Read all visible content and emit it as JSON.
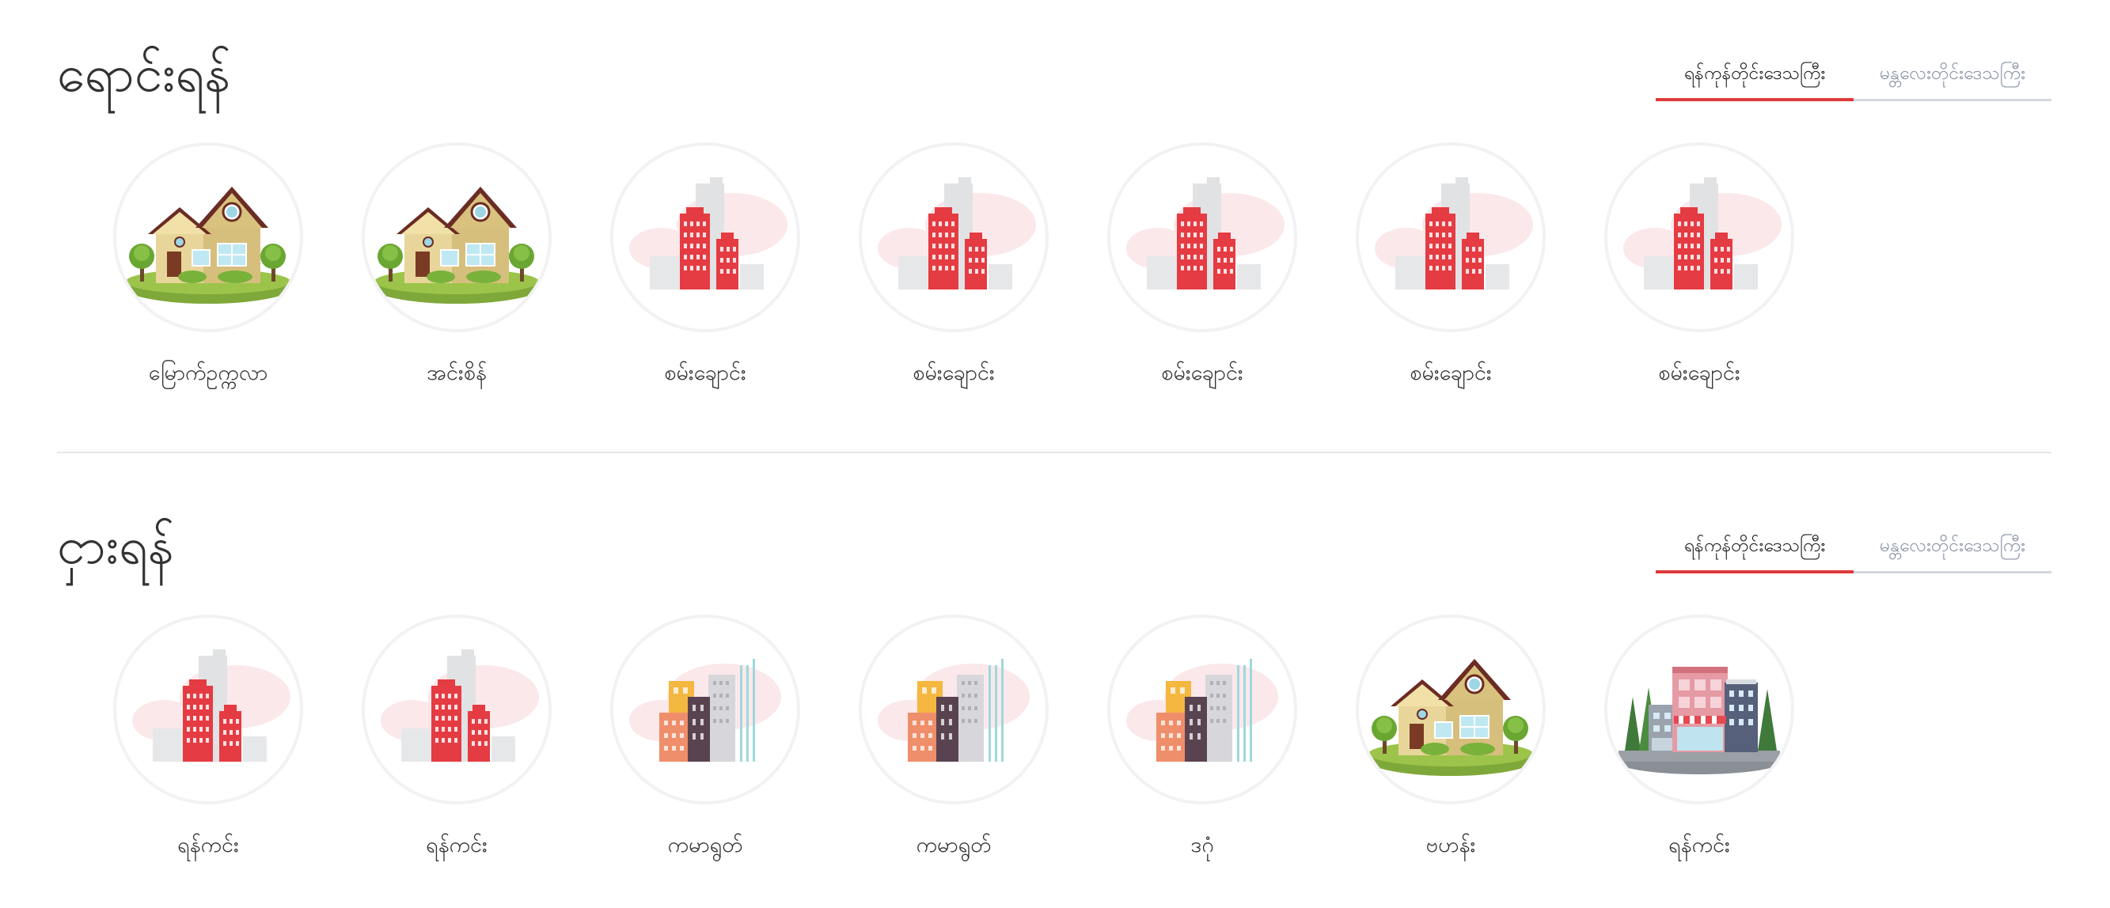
{
  "sale": {
    "title": "ရောင်းရန်",
    "tabs": [
      {
        "label": "ရန်ကုန်တိုင်းဒေသကြီး",
        "active": true
      },
      {
        "label": "မန္တလေးတိုင်းဒေသကြီး",
        "active": false
      }
    ],
    "items": [
      {
        "label": "မြောက်ဥက္ကလာ",
        "icon": "house-icon"
      },
      {
        "label": "အင်းစိန်",
        "icon": "house-icon"
      },
      {
        "label": "စမ်းချောင်း",
        "icon": "red-buildings-icon"
      },
      {
        "label": "စမ်းချောင်း",
        "icon": "red-buildings-icon"
      },
      {
        "label": "စမ်းချောင်း",
        "icon": "red-buildings-icon"
      },
      {
        "label": "စမ်းချောင်း",
        "icon": "red-buildings-icon"
      },
      {
        "label": "စမ်းချောင်း",
        "icon": "red-buildings-icon"
      }
    ]
  },
  "rent": {
    "title": "ငှားရန်",
    "tabs": [
      {
        "label": "ရန်ကုန်တိုင်းဒေသကြီး",
        "active": true
      },
      {
        "label": "မန္တလေးတိုင်းဒေသကြီး",
        "active": false
      }
    ],
    "items": [
      {
        "label": "ရန်ကင်း",
        "icon": "red-buildings-icon"
      },
      {
        "label": "ရန်ကင်း",
        "icon": "red-buildings-icon"
      },
      {
        "label": "ကမာရွတ်",
        "icon": "city-buildings-icon"
      },
      {
        "label": "ကမာရွတ်",
        "icon": "city-buildings-icon"
      },
      {
        "label": "ဒဂုံ",
        "icon": "city-buildings-icon"
      },
      {
        "label": "ဗဟန်း",
        "icon": "house-icon"
      },
      {
        "label": "ရန်ကင်း",
        "icon": "commercial-building-icon"
      }
    ]
  },
  "colors": {
    "accent": "#e03a3a",
    "inactive_tab": "#8a93a6",
    "divider": "#e6e6e6"
  }
}
